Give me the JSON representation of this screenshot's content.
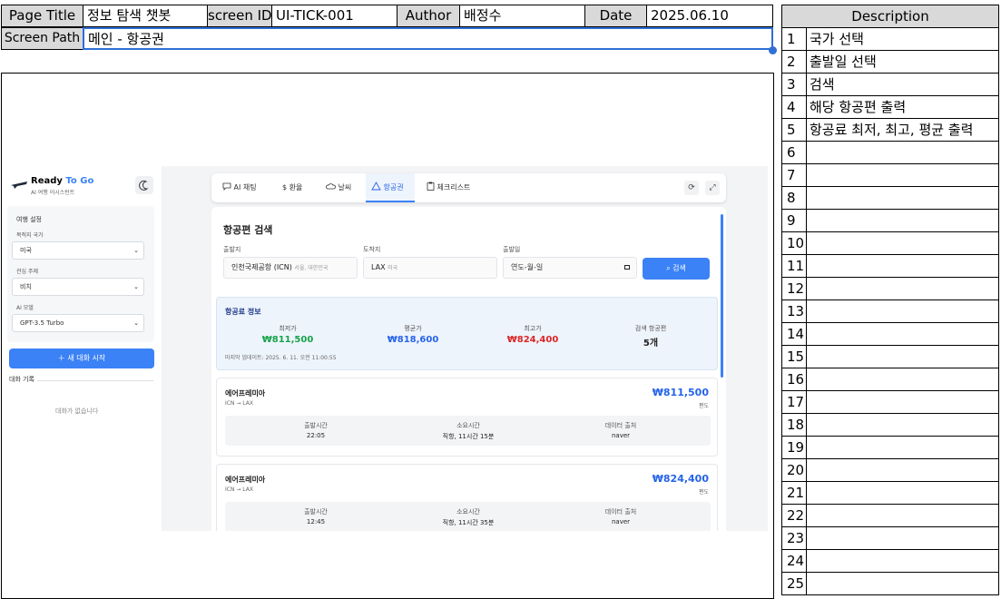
{
  "header": {
    "page_title_label": "Page Title",
    "page_title": "정보 탐색 챗봇",
    "screen_id_label": "screen ID",
    "screen_id": "UI-TICK-001",
    "author_label": "Author",
    "author": "배정수",
    "date_label": "Date",
    "date": "2025.06.10",
    "screen_path_label": "Screen Path",
    "screen_path": "메인 - 항공권"
  },
  "description": {
    "title": "Description",
    "rows": [
      {
        "num": "1",
        "text": "국가 선택"
      },
      {
        "num": "2",
        "text": "출발일 선택"
      },
      {
        "num": "3",
        "text": "검색"
      },
      {
        "num": "4",
        "text": "해당 항공편 출력"
      },
      {
        "num": "5",
        "text": "항공료 최저, 최고, 평균 출력"
      },
      {
        "num": "6",
        "text": ""
      },
      {
        "num": "7",
        "text": ""
      },
      {
        "num": "8",
        "text": ""
      },
      {
        "num": "9",
        "text": ""
      },
      {
        "num": "10",
        "text": ""
      },
      {
        "num": "11",
        "text": ""
      },
      {
        "num": "12",
        "text": ""
      },
      {
        "num": "13",
        "text": ""
      },
      {
        "num": "14",
        "text": ""
      },
      {
        "num": "15",
        "text": ""
      },
      {
        "num": "16",
        "text": ""
      },
      {
        "num": "17",
        "text": ""
      },
      {
        "num": "18",
        "text": ""
      },
      {
        "num": "19",
        "text": ""
      },
      {
        "num": "20",
        "text": ""
      },
      {
        "num": "21",
        "text": ""
      },
      {
        "num": "22",
        "text": ""
      },
      {
        "num": "23",
        "text": ""
      },
      {
        "num": "24",
        "text": ""
      },
      {
        "num": "25",
        "text": ""
      }
    ]
  },
  "app": {
    "brand_ready": "Ready",
    "brand_togo": "To Go",
    "brand_sub": "AI 여행 어시스턴트",
    "sidebar": {
      "section_title": "여행 설정",
      "country_label": "목적지 국가",
      "country_value": "미국",
      "theme_label": "관심 주제",
      "theme_value": "비치",
      "model_label": "AI 모델",
      "model_value": "GPT-3.5 Turbo",
      "new_chat": "＋ 새 대화 시작",
      "history_title": "대화 기록",
      "history_empty": "대화가 없습니다"
    },
    "tabs": [
      {
        "icon": "chat-icon",
        "label": "AI 채팅"
      },
      {
        "icon": "dollar-icon",
        "label": "환율"
      },
      {
        "icon": "cloud-icon",
        "label": "날씨"
      },
      {
        "icon": "plane-icon",
        "label": "항공권"
      },
      {
        "icon": "clipboard-icon",
        "label": "체크리스트"
      }
    ],
    "search": {
      "title": "항공편 검색",
      "from_label": "출발지",
      "from_value": "인천국제공항 (ICN)",
      "from_hint": "서울, 대한민국",
      "to_label": "도착지",
      "to_value": "LAX",
      "to_hint": "미국",
      "date_label": "출발일",
      "date_placeholder": "연도-월-일",
      "button": "검색"
    },
    "price_info": {
      "title": "항공료 정보",
      "min_label": "최저가",
      "min_value": "₩811,500",
      "avg_label": "평균가",
      "avg_value": "₩818,600",
      "max_label": "최고가",
      "max_value": "₩824,400",
      "count_label": "검색 항공편",
      "count_value": "5개",
      "updated": "마지막 업데이트: 2025. 6. 11. 오전 11:00:55"
    },
    "flights": [
      {
        "airline": "에어프레미아",
        "route": "ICN → LAX",
        "price": "₩811,500",
        "trip": "편도",
        "dep_label": "출발시간",
        "dep": "22:05",
        "dur_label": "소요시간",
        "dur": "직항, 11시간 15분",
        "src_label": "데이터 출처",
        "src": "naver"
      },
      {
        "airline": "에어프레미아",
        "route": "ICN → LAX",
        "price": "₩824,400",
        "trip": "편도",
        "dep_label": "출발시간",
        "dep": "12:45",
        "dur_label": "소요시간",
        "dur": "직항, 11시간 35분",
        "src_label": "데이터 출처",
        "src": "naver"
      }
    ]
  },
  "colors": {
    "accent": "#3b82f6",
    "green": "#16a34a",
    "blue": "#2563eb",
    "red": "#dc2626",
    "price_bg": "#eef4fc"
  }
}
